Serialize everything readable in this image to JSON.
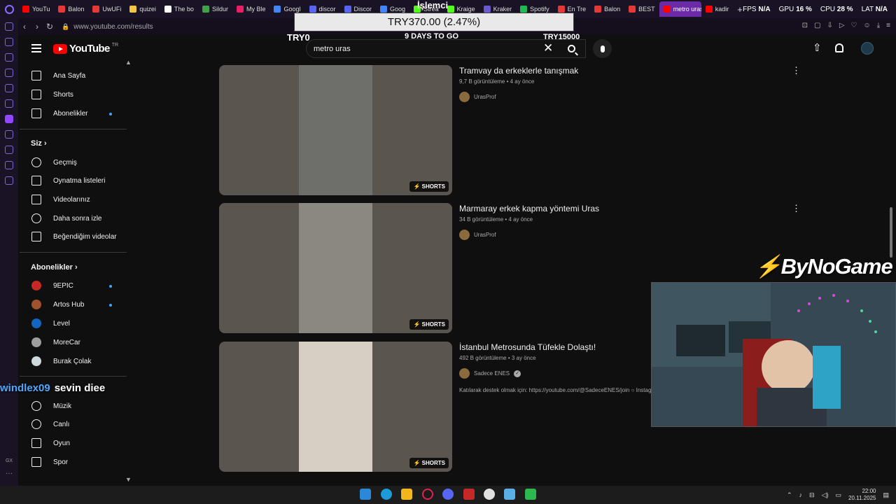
{
  "browser": {
    "tabs": [
      {
        "label": "YouTu",
        "color": "#ff0000"
      },
      {
        "label": "Balon",
        "color": "#e53935"
      },
      {
        "label": "UwUFi",
        "color": "#e53935"
      },
      {
        "label": "quizei",
        "color": "#f4c542"
      },
      {
        "label": "The bo",
        "color": "#ffffff"
      },
      {
        "label": "Sildur",
        "color": "#43a047"
      },
      {
        "label": "My Ble",
        "color": "#e91e63"
      },
      {
        "label": "Googl",
        "color": "#4285f4"
      },
      {
        "label": "discor",
        "color": "#5865f2"
      },
      {
        "label": "Discor",
        "color": "#5865f2"
      },
      {
        "label": "Goog",
        "color": "#4285f4"
      },
      {
        "label": "Strea",
        "color": "#53fc18"
      },
      {
        "label": "Kraige",
        "color": "#53fc18"
      },
      {
        "label": "Kraker",
        "color": "#6a5acd"
      },
      {
        "label": "Spotify",
        "color": "#1db954"
      },
      {
        "label": "En Tre",
        "color": "#e53935"
      },
      {
        "label": "Balon",
        "color": "#e53935"
      },
      {
        "label": "BEST",
        "color": "#e53935"
      },
      {
        "label": "metro uras",
        "color": "#ff0000"
      },
      {
        "label": "kadir",
        "color": "#ff0000"
      }
    ],
    "new_tab": "+",
    "url": "www.youtube.com/results",
    "stats": {
      "fps_label": "FPS",
      "fps_value": "N/A",
      "gpu_label": "GPU",
      "gpu_value": "16 %",
      "cpu_label": "CPU",
      "cpu_value": "28 %",
      "lat_label": "LAT",
      "lat_value": "N/A"
    }
  },
  "promo": {
    "label": "İşlemci",
    "price": "TRY370.00 (2.47%)",
    "low": "TRY0",
    "days": "9 DAYS TO GO",
    "high": "TRY15000"
  },
  "youtube": {
    "logo_text": "YouTube",
    "region": "TR",
    "search_value": "metro uras",
    "clear": "✕"
  },
  "sidebar": {
    "main": [
      {
        "label": "Ana Sayfa"
      },
      {
        "label": "Shorts"
      },
      {
        "label": "Abonelikler",
        "dot": true
      }
    ],
    "you_header": "Siz",
    "you_chevron": "›",
    "you": [
      {
        "label": "Geçmiş"
      },
      {
        "label": "Oynatma listeleri"
      },
      {
        "label": "Videolarınız"
      },
      {
        "label": "Daha sonra izle"
      },
      {
        "label": "Beğendiğim videolar"
      }
    ],
    "subs_header": "Abonelikler",
    "subs_chevron": "›",
    "subs": [
      {
        "label": "9EPIC",
        "dot": true,
        "color": "#c62828"
      },
      {
        "label": "Artos Hub",
        "dot": true,
        "color": "#a0522d"
      },
      {
        "label": "Level",
        "dot": false,
        "color": "#1565c0"
      },
      {
        "label": "MoreCar",
        "dot": false,
        "color": "#9e9e9e"
      },
      {
        "label": "Burak Çolak",
        "dot": false,
        "color": "#cfd8dc"
      }
    ],
    "explore": [
      {
        "label": "Müzik"
      },
      {
        "label": "Canlı"
      },
      {
        "label": "Oyun"
      },
      {
        "label": "Spor"
      }
    ]
  },
  "results": [
    {
      "title": "Tramvay da erkeklerle tanışmak",
      "views": "9,7 B görüntüleme",
      "age": "4 ay önce",
      "channel": "UrasProf",
      "verified": false,
      "description": "",
      "badge": "SHORTS",
      "thumb_color": "#6e6e6a"
    },
    {
      "title": "Marmaray erkek kapma yöntemi Uras",
      "views": "34 B görüntüleme",
      "age": "4 ay önce",
      "channel": "UrasProf",
      "verified": false,
      "description": "",
      "badge": "SHORTS",
      "thumb_color": "#8a8880"
    },
    {
      "title": "İstanbul Metrosunda Tüfekle Dolaştı!",
      "views": "492 B görüntüleme",
      "age": "3 ay önce",
      "channel": "Sadece ENES",
      "verified": true,
      "description": "Katılarak destek olmak için: https://youtube.com/@SadeceENES/join ○ Instag",
      "badge": "SHORTS",
      "thumb_color": "#d8cfc4"
    }
  ],
  "overlay": {
    "brand": "ByNoGame",
    "chat_user": "windlex09",
    "chat_message": "sevin diee"
  },
  "taskbar": {
    "time": "22:00",
    "date": "20.11.2025"
  }
}
